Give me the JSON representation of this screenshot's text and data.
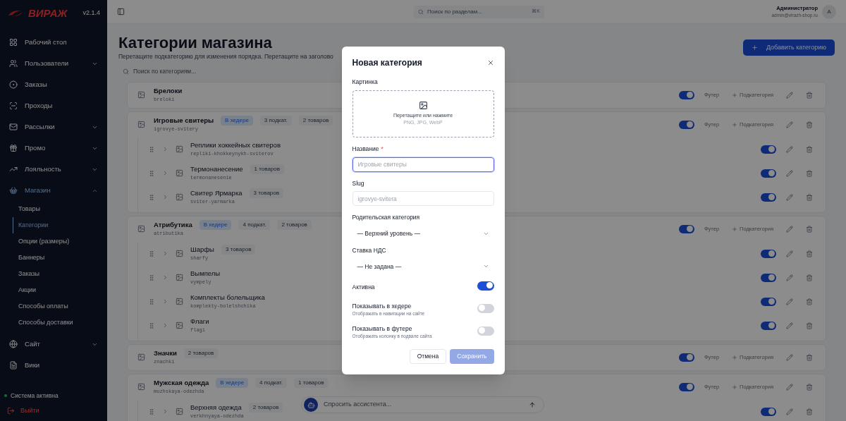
{
  "sidebar": {
    "logo": "ВИРАЖ",
    "version": "v2.1.4",
    "items": [
      {
        "label": "Рабочий стол",
        "kind": "link",
        "selected": false
      },
      {
        "label": "Пользователи",
        "kind": "group",
        "expanded": false,
        "selected": false
      },
      {
        "label": "Заказы",
        "kind": "link",
        "selected": false
      },
      {
        "label": "Проходы",
        "kind": "link",
        "selected": false
      },
      {
        "label": "Рассылки",
        "kind": "group",
        "expanded": false,
        "selected": false
      },
      {
        "label": "Промо",
        "kind": "group",
        "expanded": false,
        "selected": false
      },
      {
        "label": "Лояльность",
        "kind": "group",
        "expanded": false,
        "selected": false
      },
      {
        "label": "Магазин",
        "kind": "group",
        "expanded": true,
        "selected": true,
        "children": [
          {
            "label": "Товары",
            "selected": false
          },
          {
            "label": "Категории",
            "selected": true
          },
          {
            "label": "Опции (размеры)",
            "selected": false
          },
          {
            "label": "Баннеры",
            "selected": false
          },
          {
            "label": "Заказы",
            "selected": false
          },
          {
            "label": "Акции",
            "selected": false
          },
          {
            "label": "Способы оплаты",
            "selected": false
          },
          {
            "label": "Способы доставки",
            "selected": false
          }
        ]
      },
      {
        "label": "Сайт",
        "kind": "group",
        "expanded": false,
        "selected": false
      },
      {
        "label": "Вики",
        "kind": "link",
        "selected": false
      }
    ],
    "status": "Система активна",
    "logout": "Выйти"
  },
  "topbar": {
    "search_placeholder": "Поиск по разделам...",
    "shortcut": "⌘K",
    "user_name": "Администратор",
    "user_email": "admin@virazh-shop.ru",
    "avatar": "A"
  },
  "page": {
    "title": "Категории магазина",
    "subtitle": "Перетащите подкатегорию для изменения порядка. Перетащите на заголово",
    "add_button": "Добавить категорию",
    "search_placeholder": "Поиск по категориям..."
  },
  "categories": [
    {
      "name": "Брелоки",
      "slug": "breloki",
      "active": true,
      "footer": "Футер",
      "footer_on": false,
      "add_sub": "Подкатегория"
    },
    {
      "name": "Игровые свитеры",
      "slug": "igrovye-svitery",
      "badges": [
        {
          "kind": "header",
          "text": "В хедере"
        },
        {
          "kind": "count",
          "text": "3 подкат."
        },
        {
          "kind": "count",
          "text": "2 товаров"
        }
      ],
      "active": true,
      "footer": "Футер",
      "footer_on": false,
      "add_sub": "Подкатегория",
      "children": [
        {
          "name": "Реплики хоккейных свитеров",
          "slug": "repliki-khokkeynykh-sviterov",
          "active": true
        },
        {
          "name": "Термонанесение",
          "slug": "termonanesenie",
          "count": "1 товаров",
          "active": true
        },
        {
          "name": "Свитер Ярмарка",
          "slug": "sviter-yarmarka",
          "count": "3 товаров",
          "active": true
        }
      ]
    },
    {
      "name": "Атрибутика",
      "slug": "atributika",
      "badges": [
        {
          "kind": "header",
          "text": "В хедере"
        },
        {
          "kind": "count",
          "text": "4 подкат."
        },
        {
          "kind": "count",
          "text": "2 товаров"
        }
      ],
      "active": true,
      "footer": "Футер",
      "footer_on": false,
      "add_sub": "Подкатегория",
      "children": [
        {
          "name": "Шарфы",
          "slug": "sharfy",
          "count": "3 товаров",
          "active": true
        },
        {
          "name": "Вымпелы",
          "slug": "vympely",
          "active": true
        },
        {
          "name": "Комплекты болельщика",
          "slug": "komplekty-bolelshchika",
          "active": true
        },
        {
          "name": "Флаги",
          "slug": "flagi",
          "active": true
        }
      ]
    },
    {
      "name": "Значки",
      "slug": "znachki",
      "badges": [
        {
          "kind": "count",
          "text": "2 товаров"
        }
      ],
      "active": true,
      "footer": "Футер",
      "footer_on": false,
      "add_sub": "Подкатегория"
    },
    {
      "name": "Мужская одежда",
      "slug": "muzhskaya-odezhda",
      "badges": [
        {
          "kind": "header",
          "text": "В хедере"
        },
        {
          "kind": "count",
          "text": "4 подкат."
        },
        {
          "kind": "count",
          "text": "1 товаров"
        }
      ],
      "active": true,
      "footer": "Футер",
      "footer_on": false,
      "add_sub": "Подкатегория",
      "children": [
        {
          "name": "Верхняя одежда",
          "slug": "verkhnyaya-odezhda",
          "count": "2 товаров",
          "active": true
        }
      ]
    }
  ],
  "assistant": {
    "placeholder": "Спросить ассистента..."
  },
  "modal": {
    "title": "Новая категория",
    "image_label": "Картинка",
    "upload_text": "Перетащите или нажмите",
    "upload_hint": "PNG, JPG, WebP",
    "name_label": "Название",
    "required_mark": "*",
    "name_placeholder": "Игровые свитеры",
    "name_focused": true,
    "slug_label": "Slug",
    "slug_placeholder": "igrovye-svitera",
    "parent_label": "Родительская категория",
    "parent_value": "— Верхний уровень —",
    "vat_label": "Ставка НДС",
    "vat_value": "— Не задана —",
    "switches": [
      {
        "label": "Активна",
        "on": true
      },
      {
        "label": "Показывать в хедере",
        "description": "Отображать в навигации на сайте",
        "on": false
      },
      {
        "label": "Показывать в футере",
        "description": "Отображать колонку в подвале сайта",
        "on": false
      }
    ],
    "cancel": "Отмена",
    "save": "Сохранить",
    "save_disabled": true
  }
}
